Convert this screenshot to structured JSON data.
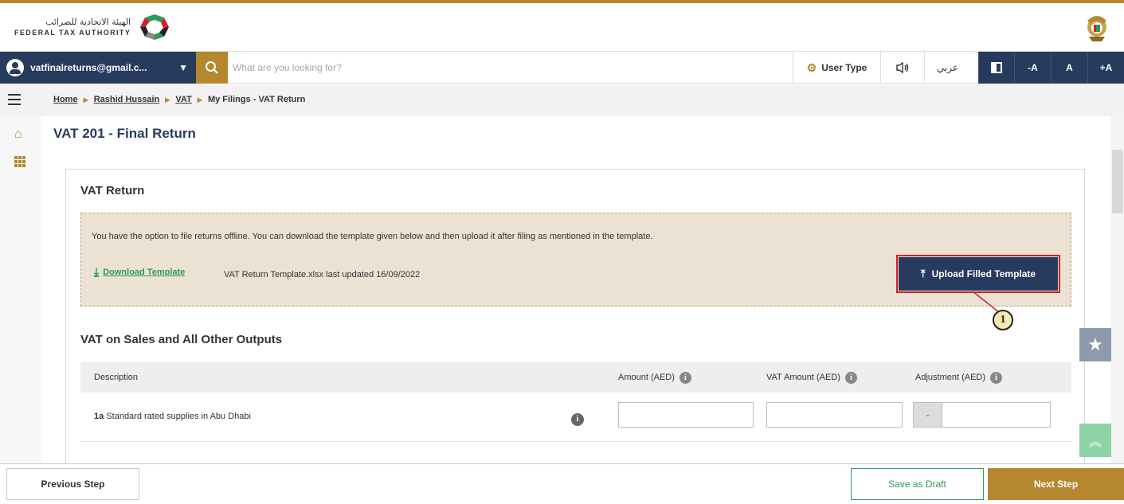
{
  "header": {
    "logo_arabic": "الهيئة الاتحادية للضرائب",
    "logo_english": "FEDERAL TAX AUTHORITY",
    "emblem_icon": "uae-emblem-icon"
  },
  "toolbar": {
    "user_email": "vatfinalreturns@gmail.c...",
    "search_placeholder": "What are you looking for?",
    "user_type_label": "User Type",
    "arabic_label": "عربي",
    "font_decrease": "-A",
    "font_normal": "A",
    "font_increase": "+A"
  },
  "breadcrumb": {
    "items": [
      "Home",
      "Rashid Hussain",
      "VAT",
      "My Filings - VAT Return"
    ]
  },
  "page": {
    "title": "VAT 201 - Final Return"
  },
  "card": {
    "title": "VAT Return",
    "offline_text": "You have the option to file returns offline. You can download the template given below and then upload it after filing as mentioned in the template.",
    "download_label": "Download Template",
    "template_info": "VAT Return Template.xlsx last updated 16/09/2022",
    "upload_label": "Upload Filled Template",
    "callout_number": "1"
  },
  "sales_section": {
    "title": "VAT on Sales and All Other Outputs",
    "columns": {
      "description": "Description",
      "amount": "Amount (AED)",
      "vat_amount": "VAT Amount (AED)",
      "adjustment": "Adjustment (AED)"
    },
    "rows": [
      {
        "code": "1a",
        "label": "Standard rated supplies in Abu Dhabi",
        "amount": "",
        "vat_amount": "",
        "adjustment_sign": "-",
        "adjustment": ""
      }
    ]
  },
  "footer": {
    "previous_label": "Previous Step",
    "draft_label": "Save as Draft",
    "next_label": "Next Step"
  },
  "colors": {
    "navy": "#263b5e",
    "gold": "#b5882f",
    "green": "#2e9a58",
    "highlight_red": "#d0202e",
    "notice_bg": "#ebe2d3"
  }
}
